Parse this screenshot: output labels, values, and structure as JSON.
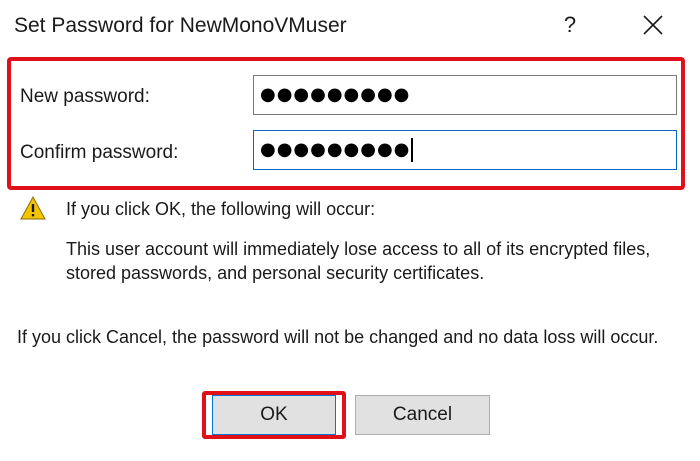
{
  "window": {
    "title": "Set Password for NewMonoVMuser",
    "help_label": "?"
  },
  "fields": {
    "new_password": {
      "label": "New password:",
      "value": "●●●●●●●●●"
    },
    "confirm_password": {
      "label": "Confirm password:",
      "value": "●●●●●●●●●"
    }
  },
  "warning": {
    "icon": "warning-triangle-icon",
    "title": "If you click OK, the following will occur:",
    "detail": "This user account will immediately lose access to all of its encrypted files, stored passwords, and personal security certificates."
  },
  "cancel_note": "If you click Cancel, the password will not be changed and no data loss will occur.",
  "buttons": {
    "ok_label": "OK",
    "cancel_label": "Cancel"
  },
  "colors": {
    "highlight": "#e0101a",
    "focus_border": "#0a64c8",
    "warning_fill": "#f5c400"
  }
}
